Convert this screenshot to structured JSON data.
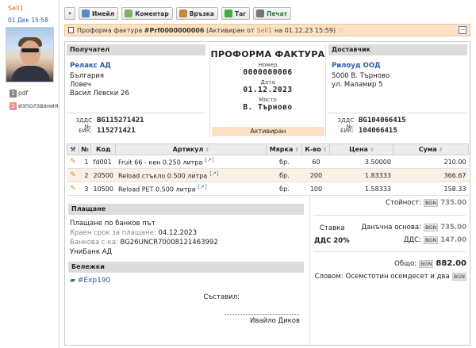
{
  "sidebar": {
    "author": "Sell1",
    "date": "01 Дек 15:58",
    "attachments": [
      {
        "count": "1",
        "label": "pdf",
        "color": "#888888"
      },
      {
        "count": "2",
        "label": "използвания",
        "color": "#e89090"
      }
    ]
  },
  "toolbar": {
    "email": "Имейл",
    "comment": "Коментар",
    "link": "Връзка",
    "tag": "Таг",
    "print": "Печат"
  },
  "titlebar": {
    "prefix": "Проформа фактура",
    "number": "#Prf0000000006",
    "activated_text": "(Активиран от",
    "activated_by": "Sell1",
    "activated_on": "на 01.12.23 15:59)"
  },
  "recipient": {
    "header": "Получател",
    "name": "Релакс АД",
    "country": "България",
    "city": "Ловеч",
    "address": "Васил Левски 26",
    "vat_label": "ЗДДС №:",
    "vat": "BG115271421",
    "eik_label": "ЕИК:",
    "eik": "115271421"
  },
  "document": {
    "title": "ПРОФОРМА ФАКТУРА",
    "number_label": "Номер",
    "number": "0000000006",
    "date_label": "Дата",
    "date": "01.12.2023",
    "place_label": "Място",
    "place": "В. Търново",
    "status": "Активиран"
  },
  "supplier": {
    "header": "Доставчик",
    "name": "Рилоуд ООД",
    "city": "5000 В. Търново",
    "address": "ул. Маламир 5",
    "vat_label": "ЗДДС №:",
    "vat": "BG104066415",
    "eik_label": "ЕИК:",
    "eik": "104066415"
  },
  "table": {
    "columns": {
      "tools": "⚒",
      "num": "№",
      "code": "Код",
      "article": "Артикул",
      "unit": "Мярка",
      "qty": "К-во",
      "price": "Цена",
      "sum": "Сума"
    },
    "rows": [
      {
        "num": "1",
        "code": "fd001",
        "article": "Fruit 66 - кен 0.250 литра",
        "unit": "бр.",
        "qty": "60",
        "price": "3.50000",
        "sum": "210.00"
      },
      {
        "num": "2",
        "code": "20500",
        "article": "Reload стъкло 0.500 литра",
        "unit": "бр.",
        "qty": "200",
        "price": "1.83333",
        "sum": "366.67"
      },
      {
        "num": "3",
        "code": "10500",
        "article": "Reload PET 0.500 литра",
        "unit": "бр.",
        "qty": "100",
        "price": "1.58333",
        "sum": "158.33"
      }
    ]
  },
  "payment": {
    "header": "Плащане",
    "method": "Плащане по банков път",
    "due_label": "Краен срок за плащане:",
    "due": "04.12.2023",
    "bank_label": "Банкова с-ка:",
    "iban": "BG26UNCR70008121463992",
    "bank": "УниБанк АД"
  },
  "notes": {
    "header": "Бележки",
    "tag": "#Exp190"
  },
  "signature": {
    "label": "Съставил:",
    "name": "Ивайло Диков"
  },
  "totals": {
    "currency": "BGN",
    "value_label": "Стойност:",
    "value": "735.00",
    "rate_label": "Ставка",
    "rate": "ДДС 20%",
    "base_label": "Данъчна основа:",
    "base": "735.00",
    "vat_label": "ДДС:",
    "vat": "147.00",
    "total_label": "Общо:",
    "total": "882.00",
    "words_label": "Словом:",
    "words": "Осемстотин осемдесет и два"
  }
}
